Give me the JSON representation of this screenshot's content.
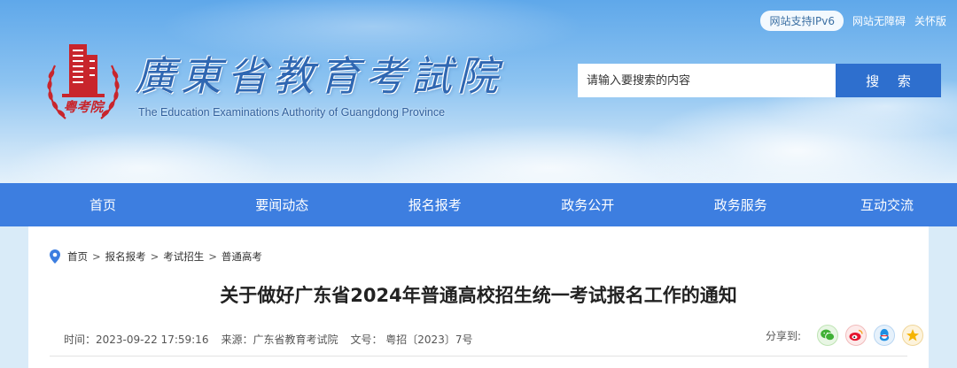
{
  "top_links": {
    "ipv6": "网站支持IPv6",
    "accessibility": "网站无障碍",
    "care_version": "关怀版"
  },
  "header": {
    "title": "廣東省教育考試院",
    "subtitle": "The Education Examinations Authority of Guangdong Province",
    "logo_text": "粤考院"
  },
  "search": {
    "placeholder": "请输入要搜索的内容",
    "button_label": "搜 索"
  },
  "nav": {
    "items": [
      "首页",
      "要闻动态",
      "报名报考",
      "政务公开",
      "政务服务",
      "互动交流"
    ]
  },
  "breadcrumb": {
    "items": [
      "首页",
      "报名报考",
      "考试招生",
      "普通高考"
    ],
    "separator": ">"
  },
  "article": {
    "title": "关于做好广东省2024年普通高校招生统一考试报名工作的通知",
    "time": "时间：2023-09-22 17:59:16",
    "source": "来源：广东省教育考试院",
    "doc_no": "文号： 粤招〔2023〕7号"
  },
  "share": {
    "label": "分享到:",
    "targets": [
      "wechat-icon",
      "weibo-icon",
      "qq-icon",
      "qzone-icon"
    ]
  },
  "colors": {
    "nav_bg": "#3d7ee0",
    "search_button": "#2e6fce",
    "logo_red": "#c8252c",
    "title_blue": "#2f67b2"
  }
}
